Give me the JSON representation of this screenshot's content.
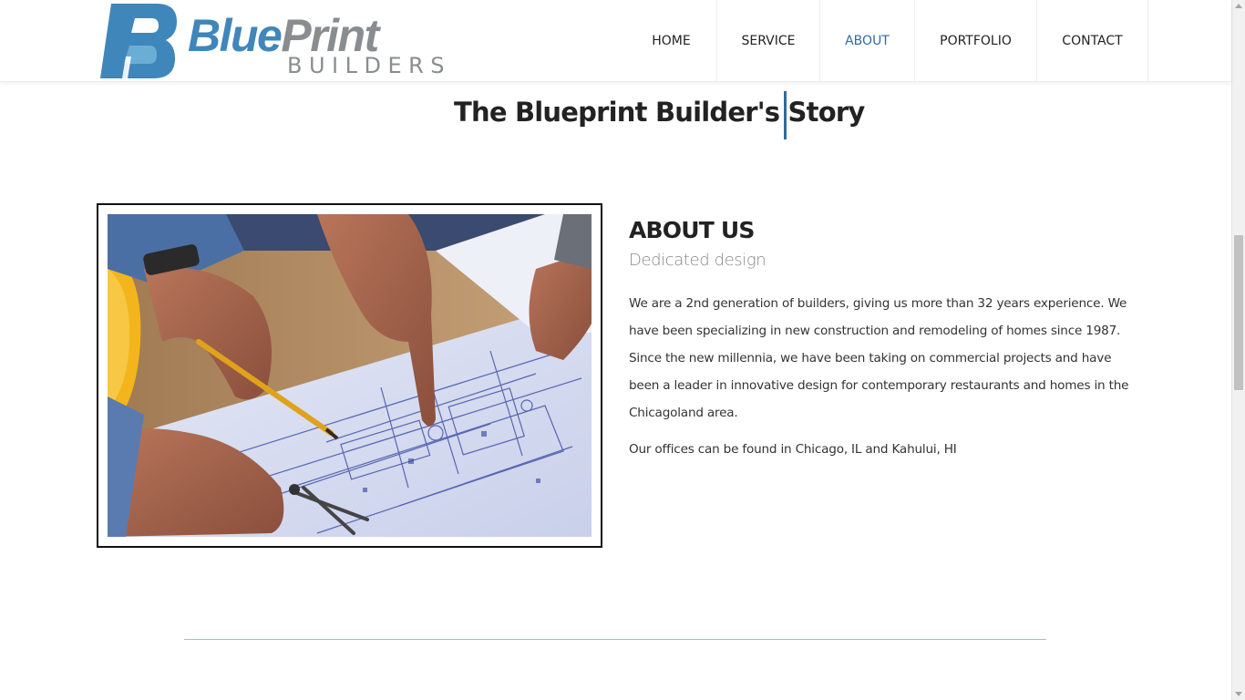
{
  "brand": {
    "logo_main_blue": "Blue",
    "logo_main_grey": "Print",
    "logo_sub": "BUILDERS",
    "colors": {
      "blue": "#3f86bb",
      "light_blue": "#6aaed6",
      "grey": "#8a8d90"
    }
  },
  "nav": {
    "items": [
      {
        "label": "HOME",
        "active": false
      },
      {
        "label": "SERVICE",
        "active": false
      },
      {
        "label": "ABOUT",
        "active": true
      },
      {
        "label": "PORTFOLIO",
        "active": false
      },
      {
        "label": "CONTACT",
        "active": false
      }
    ],
    "active_color": "#2f6aa3"
  },
  "section": {
    "title": "The Blueprint Builder's Story"
  },
  "about": {
    "heading": "ABOUT US",
    "subheading": "Dedicated design",
    "paragraph1": "We are a 2nd generation of builders, giving us more than 32 years experience. We have been specializing in new construction and remodeling of homes since 1987. Since the new millennia, we have been taking on commercial projects and have been a leader in innovative design for contemporary restaurants and homes in the Chicagoland area.",
    "paragraph2": "Our offices can be found in Chicago, IL and Kahului, HI"
  },
  "photo": {
    "subject": "hands-pointing-at-blueprint-with-pencil-and-compass"
  }
}
